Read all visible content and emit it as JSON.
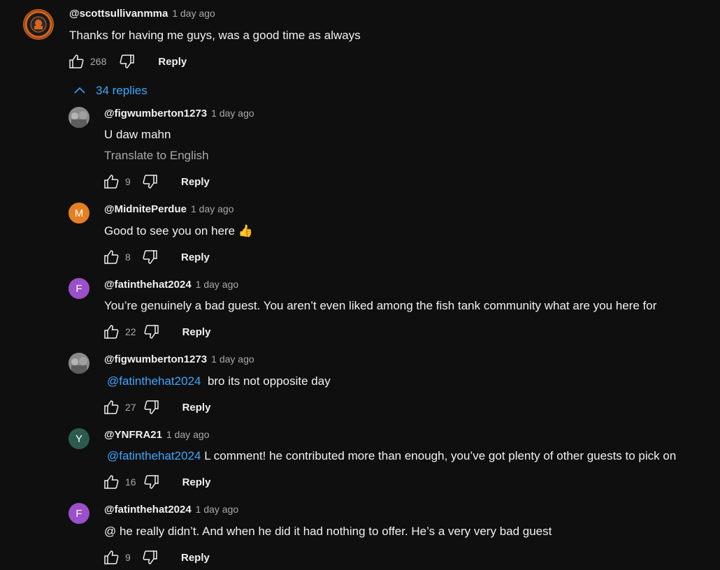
{
  "main_comment": {
    "handle": "@scottsullivanmma",
    "time": "1 day ago",
    "text": "Thanks for having me guys, was a good time as always",
    "likes": "268",
    "reply_label": "Reply"
  },
  "replies_toggle": "34 replies",
  "replies": [
    {
      "handle": "@figwumberton1273",
      "time": "1 day ago",
      "text": "U daw mahn",
      "translate": "Translate to English",
      "likes": "9",
      "reply_label": "Reply"
    },
    {
      "handle": "@MidnitePerdue",
      "time": "1 day ago",
      "avatar_letter": "M",
      "avatar_color": "#e67e22",
      "text": "Good to see you on here 👍",
      "likes": "8",
      "reply_label": "Reply"
    },
    {
      "handle": "@fatinthehat2024",
      "time": "1 day ago",
      "avatar_letter": "F",
      "avatar_color": "#9b4fc9",
      "text": "You’re genuinely a bad guest. You aren’t even liked among the fish tank community what are you here for",
      "likes": "22",
      "reply_label": "Reply"
    },
    {
      "handle": "@figwumberton1273",
      "time": "1 day ago",
      "mention": "@fatinthehat2024",
      "text": "bro its not opposite day",
      "likes": "27",
      "reply_label": "Reply"
    },
    {
      "handle": "@YNFRA21",
      "time": "1 day ago",
      "avatar_letter": "Y",
      "avatar_color": "#2d5a4e",
      "mention": "@fatinthehat2024",
      "text": "L comment! he contributed more than enough, you’ve got plenty of other guests to pick on",
      "likes": "16",
      "reply_label": "Reply"
    },
    {
      "handle": "@fatinthehat2024",
      "time": "1 day ago",
      "avatar_letter": "F",
      "avatar_color": "#9b4fc9",
      "text": "@ he really didn’t. And when he did it had nothing to offer. He’s a very very bad guest",
      "likes": "9",
      "reply_label": "Reply"
    }
  ]
}
